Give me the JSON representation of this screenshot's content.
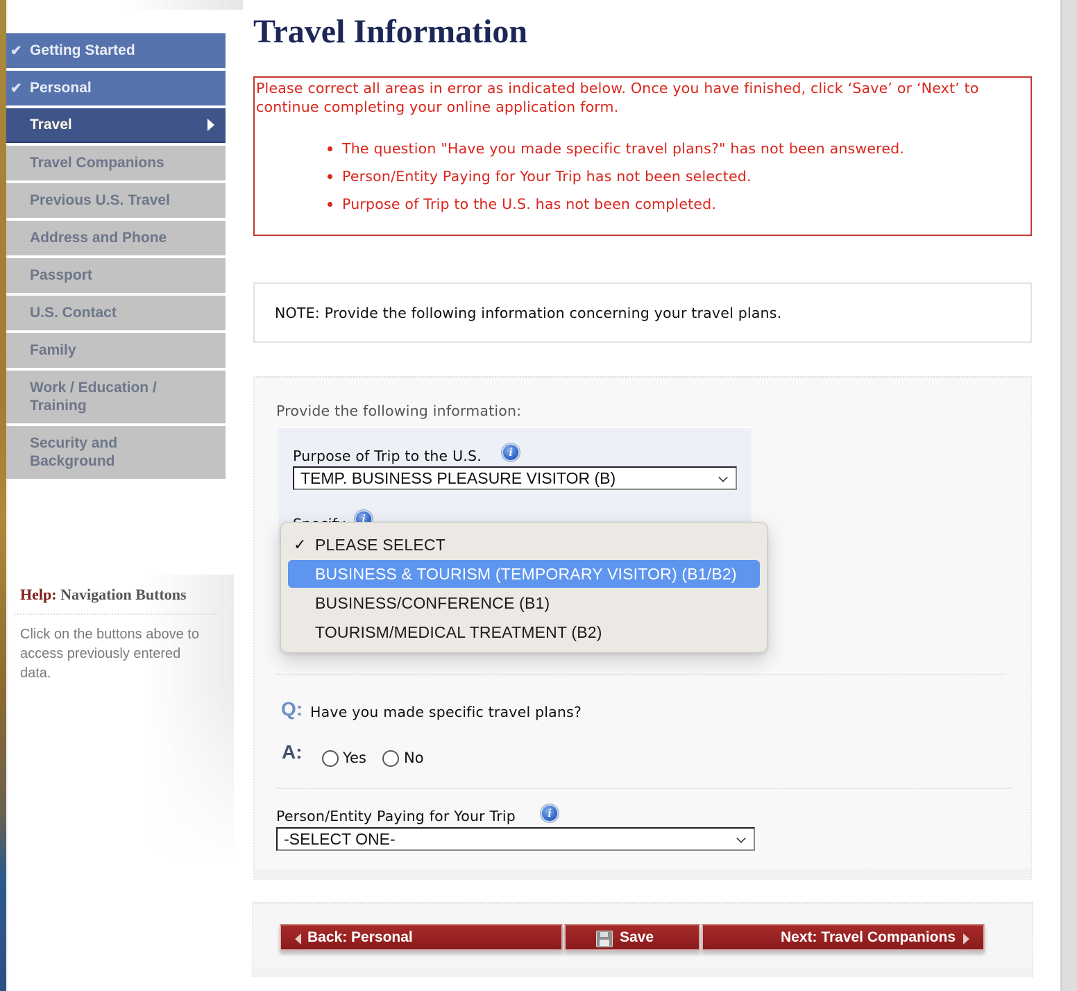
{
  "page": {
    "title": "Travel Information"
  },
  "sidebar": {
    "items": [
      {
        "label": "Getting Started",
        "state": "done"
      },
      {
        "label": "Personal",
        "state": "done"
      },
      {
        "label": "Travel",
        "state": "current"
      },
      {
        "label": "Travel Companions",
        "state": "todo"
      },
      {
        "label": "Previous U.S. Travel",
        "state": "todo"
      },
      {
        "label": "Address and Phone",
        "state": "todo"
      },
      {
        "label": "Passport",
        "state": "todo"
      },
      {
        "label": "U.S. Contact",
        "state": "todo"
      },
      {
        "label": "Family",
        "state": "todo"
      },
      {
        "label": "Work / Education / Training",
        "state": "todo"
      },
      {
        "label": "Security and Background",
        "state": "todo"
      }
    ],
    "done_icon": "check-icon",
    "current_icon": "triangle-right-icon"
  },
  "help": {
    "prefix": "Help:",
    "title": "Navigation Buttons",
    "text": "Click on the buttons above to access previously entered data."
  },
  "errors": {
    "intro": "Please correct all areas in error as indicated below. Once you have finished, click ‘Save’ or ‘Next’ to continue completing your online application form.",
    "items": [
      "The question \"Have you made specific travel plans?\" has not been answered.",
      "Person/Entity Paying for Your Trip has not been selected.",
      "Purpose of Trip to the U.S. has not been completed."
    ],
    "color": "#d9261c"
  },
  "note": {
    "text": "NOTE: Provide the following information concerning your travel plans."
  },
  "form": {
    "intro": "Provide the following information:",
    "purpose": {
      "label": "Purpose of Trip to the U.S.",
      "value": "TEMP. BUSINESS PLEASURE VISITOR (B)"
    },
    "specify": {
      "label": "Specify",
      "options": [
        {
          "label": "PLEASE SELECT",
          "checked": true,
          "highlighted": false
        },
        {
          "label": "BUSINESS & TOURISM (TEMPORARY VISITOR) (B1/B2)",
          "checked": false,
          "highlighted": true
        },
        {
          "label": "BUSINESS/CONFERENCE (B1)",
          "checked": false,
          "highlighted": false
        },
        {
          "label": "TOURISM/MEDICAL TREATMENT (B2)",
          "checked": false,
          "highlighted": false
        }
      ]
    },
    "travel_plans": {
      "q_label": "Q:",
      "question": "Have you made specific travel plans?",
      "a_label": "A:",
      "options": [
        "Yes",
        "No"
      ],
      "selected": null
    },
    "payer": {
      "label": "Person/Entity Paying for Your Trip",
      "value": "-SELECT ONE-"
    }
  },
  "buttons": {
    "back": "Back: Personal",
    "save": "Save",
    "next": "Next: Travel Companions"
  },
  "colors": {
    "nav_done": "#5673ad",
    "nav_current": "#3f5488",
    "nav_todo": "#c2c2c2",
    "button_red": "#9a2222",
    "dropdown_highlight": "#5e95ee",
    "title_navy": "#1c2757"
  }
}
